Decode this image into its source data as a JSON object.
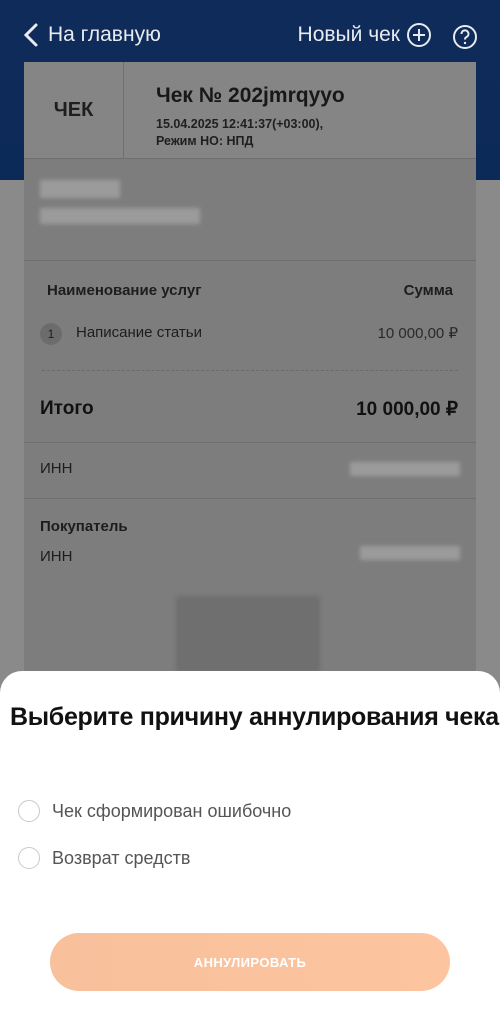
{
  "header": {
    "back_label": "На главную",
    "new_check_label": "Новый чек"
  },
  "receipt": {
    "tag": "ЧЕК",
    "number": "Чек № 202jmrqyyo",
    "datetime": "15.04.2025 12:41:37(+03:00),",
    "mode": "Режим НО: НПД",
    "services_header": "Наименование услуг",
    "sum_header": "Сумма",
    "items": [
      {
        "no": "1",
        "name": "Написание статьи",
        "sum": "10 000,00 ₽"
      }
    ],
    "total_label": "Итого",
    "total_value": "10 000,00 ₽",
    "inn_label": "ИНН",
    "buyer_label": "Покупатель",
    "buyer_inn_label": "ИНН"
  },
  "sheet": {
    "title": "Выберите причину аннулирования чека",
    "options": [
      "Чек сформирован ошибочно",
      "Возврат средств"
    ],
    "button_label": "АННУЛИРОВАТЬ"
  },
  "colors": {
    "header_bg": "#0f2b5a",
    "button_bg": "#f8c09b",
    "overlay": "#8a8a8a"
  }
}
